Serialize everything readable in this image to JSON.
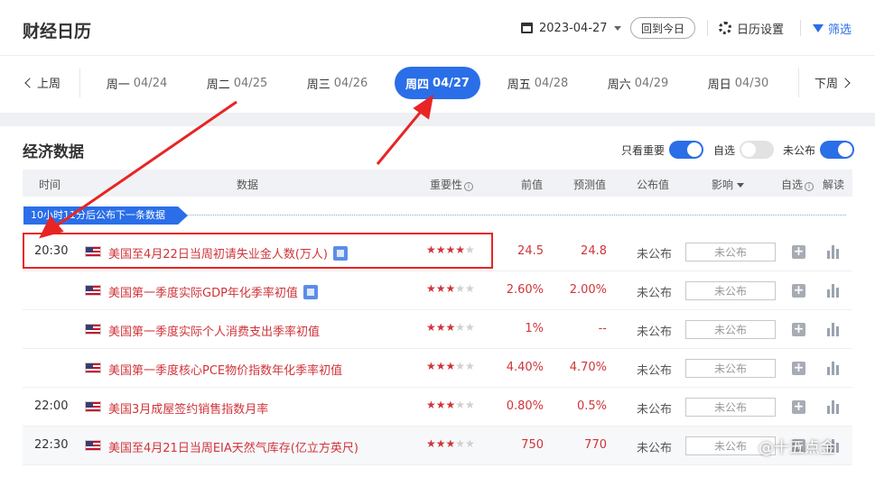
{
  "header": {
    "title": "财经日历",
    "date": "2023-04-27",
    "today_label": "回到今日",
    "settings_label": "日历设置",
    "filter_label": "筛选"
  },
  "week_nav": {
    "prev_label": "上周",
    "next_label": "下周",
    "days": [
      {
        "weekday": "周一",
        "date": "04/24",
        "active": false
      },
      {
        "weekday": "周二",
        "date": "04/25",
        "active": false
      },
      {
        "weekday": "周三",
        "date": "04/26",
        "active": false
      },
      {
        "weekday": "周四",
        "date": "04/27",
        "active": true
      },
      {
        "weekday": "周五",
        "date": "04/28",
        "active": false
      },
      {
        "weekday": "周六",
        "date": "04/29",
        "active": false
      },
      {
        "weekday": "周日",
        "date": "04/30",
        "active": false
      }
    ]
  },
  "section": {
    "title": "经济数据",
    "toggles": [
      {
        "label": "只看重要",
        "on": true
      },
      {
        "label": "自选",
        "on": false
      },
      {
        "label": "未公布",
        "on": true
      }
    ]
  },
  "table": {
    "headers": {
      "time": "时间",
      "data": "数据",
      "importance": "重要性",
      "previous": "前值",
      "forecast": "预测值",
      "published": "公布值",
      "impact": "影响",
      "watch": "自选",
      "explain": "解读"
    },
    "banner": "10小时11分后公布下一条数据",
    "rows": [
      {
        "time": "20:30",
        "name": "美国至4月22日当周初请失业金人数(万人)",
        "stars": 4,
        "has_doc": true,
        "previous": "24.5",
        "forecast": "24.8",
        "published": "未公布",
        "impact": "未公布",
        "shaded": false
      },
      {
        "time": "",
        "name": "美国第一季度实际GDP年化季率初值",
        "stars": 3,
        "has_doc": true,
        "previous": "2.60%",
        "forecast": "2.00%",
        "published": "未公布",
        "impact": "未公布",
        "shaded": false
      },
      {
        "time": "",
        "name": "美国第一季度实际个人消费支出季率初值",
        "stars": 3,
        "has_doc": false,
        "previous": "1%",
        "forecast": "--",
        "published": "未公布",
        "impact": "未公布",
        "shaded": false
      },
      {
        "time": "",
        "name": "美国第一季度核心PCE物价指数年化季率初值",
        "stars": 3,
        "has_doc": false,
        "previous": "4.40%",
        "forecast": "4.70%",
        "published": "未公布",
        "impact": "未公布",
        "shaded": false
      },
      {
        "time": "22:00",
        "name": "美国3月成屋签约销售指数月率",
        "stars": 3,
        "has_doc": false,
        "previous": "0.80%",
        "forecast": "0.5%",
        "published": "未公布",
        "impact": "未公布",
        "shaded": false
      },
      {
        "time": "22:30",
        "name": "美国至4月21日当周EIA天然气库存(亿立方英尺)",
        "stars": 3,
        "has_doc": false,
        "previous": "750",
        "forecast": "770",
        "published": "未公布",
        "impact": "未公布",
        "shaded": true
      }
    ]
  },
  "watermark": "@十五点金",
  "colors": {
    "accent": "#2a6ee8",
    "red": "#d0343a",
    "annotation": "#e82424"
  }
}
